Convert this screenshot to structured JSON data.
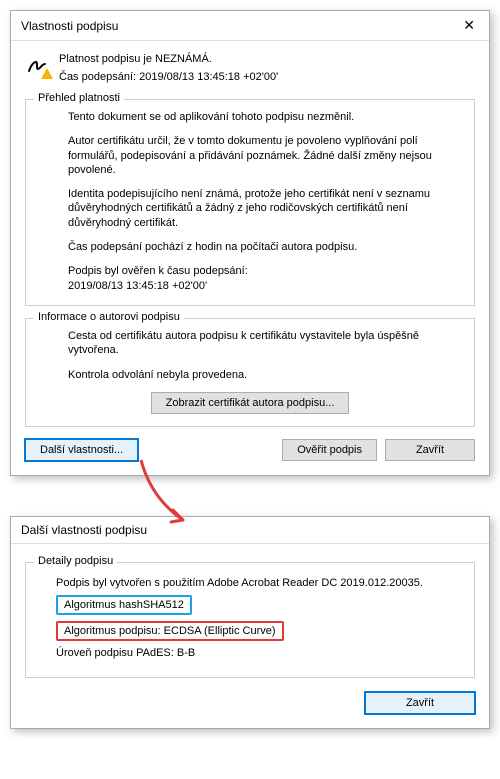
{
  "dialog1": {
    "title": "Vlastnosti podpisu",
    "summary_line1": "Platnost podpisu je NEZNÁMÁ.",
    "summary_line2": "Čas podepsání:  2019/08/13 13:45:18 +02'00'",
    "group1": {
      "title": "Přehled platnosti",
      "p1": "Tento dokument se od aplikování tohoto podpisu nezměnil.",
      "p2": "Autor certifikátu určil, že v tomto dokumentu je povoleno vyplňování polí formulářů, podepisování a přidávání poznámek. Žádné další změny nejsou povolené.",
      "p3": "Identita podepisujícího není známá, protože jeho certifikát není v seznamu důvěryhodných certifikátů a žádný z jeho rodičovských certifikátů není důvěryhodný certifikát.",
      "p4": "Čas podepsání pochází z hodin na počítači autora podpisu.",
      "p5a": "Podpis byl ověřen k času podepsání:",
      "p5b": "2019/08/13 13:45:18 +02'00'"
    },
    "group2": {
      "title": "Informace o autorovi podpisu",
      "p1": "Cesta od certifikátu autora podpisu k certifikátu vystavitele byla úspěšně vytvořena.",
      "p2": "Kontrola odvolání nebyla provedena.",
      "button": "Zobrazit certifikát autora podpisu..."
    },
    "buttons": {
      "more": "Další vlastnosti...",
      "verify": "Ověřit podpis",
      "close": "Zavřít"
    }
  },
  "dialog2": {
    "title": "Další vlastnosti podpisu",
    "group": {
      "title": "Detaily podpisu",
      "p1": "Podpis byl vytvořen s použitím Adobe Acrobat Reader DC 2019.012.20035.",
      "hash": "Algoritmus hashSHA512",
      "sig": "Algoritmus podpisu: ECDSA (Elliptic Curve)",
      "level": "Úroveň podpisu PAdES: B-B"
    },
    "close": "Zavřít"
  }
}
